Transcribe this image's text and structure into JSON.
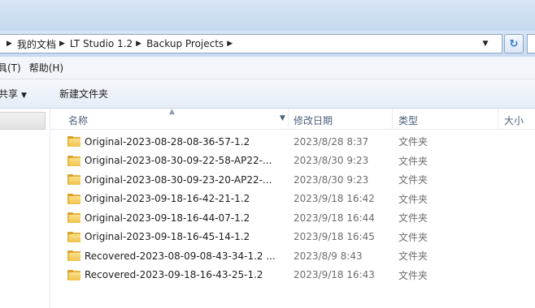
{
  "address": {
    "breadcrumbs": [
      "我的文档",
      "LT Studio 1.2",
      "Backup Projects"
    ]
  },
  "menu": {
    "items": [
      "具(T)",
      "帮助(H)"
    ]
  },
  "toolbar": {
    "share_label": "共享",
    "new_folder_label": "新建文件夹"
  },
  "columns": {
    "name": "名称",
    "date": "修改日期",
    "type": "类型",
    "size": "大小"
  },
  "files": [
    {
      "name": "Original-2023-08-28-08-36-57-1.2",
      "date": "2023/8/28 8:37",
      "type": "文件夹"
    },
    {
      "name": "Original-2023-08-30-09-22-58-AP22-...",
      "date": "2023/8/30 9:23",
      "type": "文件夹"
    },
    {
      "name": "Original-2023-08-30-09-23-20-AP22-...",
      "date": "2023/8/30 9:23",
      "type": "文件夹"
    },
    {
      "name": "Original-2023-09-18-16-42-21-1.2",
      "date": "2023/9/18 16:42",
      "type": "文件夹"
    },
    {
      "name": "Original-2023-09-18-16-44-07-1.2",
      "date": "2023/9/18 16:44",
      "type": "文件夹"
    },
    {
      "name": "Original-2023-09-18-16-45-14-1.2",
      "date": "2023/9/18 16:45",
      "type": "文件夹"
    },
    {
      "name": "Recovered-2023-08-09-08-43-34-1.2 ...",
      "date": "2023/8/9 8:43",
      "type": "文件夹"
    },
    {
      "name": "Recovered-2023-09-18-16-43-25-1.2",
      "date": "2023/9/18 16:43",
      "type": "文件夹"
    }
  ]
}
